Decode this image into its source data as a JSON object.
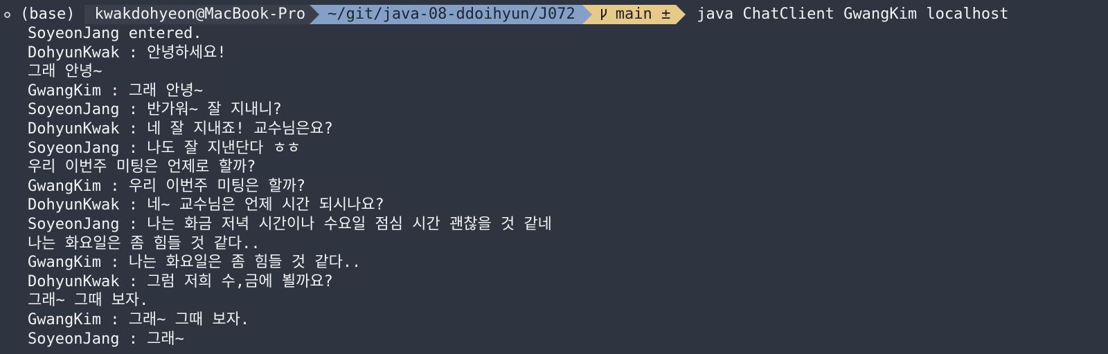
{
  "prompt": {
    "env": "(base)",
    "user_host": "kwakdohyeon@MacBook-Pro",
    "cwd": "~/git/java-08-ddoihyun/J072",
    "branch": "main ±",
    "command": "java ChatClient GwangKim localhost"
  },
  "colors": {
    "background": "#2f3441",
    "user_segment": "#3a3f4b",
    "dir_segment": "#84a0c6",
    "git_segment": "#e7c98a"
  },
  "output_lines": [
    "SoyeonJang entered.",
    "DohyunKwak : 안녕하세요!",
    "그래 안녕~",
    "GwangKim : 그래 안녕~",
    "SoyeonJang : 반가워~ 잘 지내니?",
    "DohyunKwak : 네 잘 지내죠! 교수님은요?",
    "SoyeonJang : 나도 잘 지낸단다 ㅎㅎ",
    "우리 이번주 미팅은 언제로 할까?",
    "GwangKim : 우리 이번주 미팅은 할까?",
    "DohyunKwak : 네~ 교수님은 언제 시간 되시나요?",
    "SoyeonJang : 나는 화금 저녁 시간이나 수요일 점심 시간 괜찮을 것 같네",
    "나는 화요일은 좀 힘들 것 같다..",
    "GwangKim : 나는 화요일은 좀 힘들 것 같다..",
    "DohyunKwak : 그럼 저희 수,금에 뵐까요?",
    "그래~ 그때 보자.",
    "GwangKim : 그래~ 그때 보자.",
    "SoyeonJang : 그래~"
  ]
}
